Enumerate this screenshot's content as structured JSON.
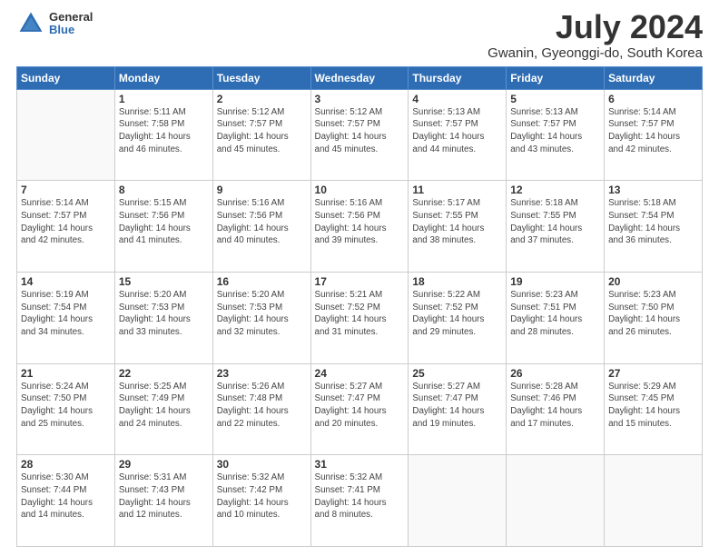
{
  "logo": {
    "general": "General",
    "blue": "Blue"
  },
  "title": "July 2024",
  "subtitle": "Gwanin, Gyeonggi-do, South Korea",
  "weekdays": [
    "Sunday",
    "Monday",
    "Tuesday",
    "Wednesday",
    "Thursday",
    "Friday",
    "Saturday"
  ],
  "weeks": [
    [
      {
        "day": "",
        "info": ""
      },
      {
        "day": "1",
        "info": "Sunrise: 5:11 AM\nSunset: 7:58 PM\nDaylight: 14 hours\nand 46 minutes."
      },
      {
        "day": "2",
        "info": "Sunrise: 5:12 AM\nSunset: 7:57 PM\nDaylight: 14 hours\nand 45 minutes."
      },
      {
        "day": "3",
        "info": "Sunrise: 5:12 AM\nSunset: 7:57 PM\nDaylight: 14 hours\nand 45 minutes."
      },
      {
        "day": "4",
        "info": "Sunrise: 5:13 AM\nSunset: 7:57 PM\nDaylight: 14 hours\nand 44 minutes."
      },
      {
        "day": "5",
        "info": "Sunrise: 5:13 AM\nSunset: 7:57 PM\nDaylight: 14 hours\nand 43 minutes."
      },
      {
        "day": "6",
        "info": "Sunrise: 5:14 AM\nSunset: 7:57 PM\nDaylight: 14 hours\nand 42 minutes."
      }
    ],
    [
      {
        "day": "7",
        "info": "Sunrise: 5:14 AM\nSunset: 7:57 PM\nDaylight: 14 hours\nand 42 minutes."
      },
      {
        "day": "8",
        "info": "Sunrise: 5:15 AM\nSunset: 7:56 PM\nDaylight: 14 hours\nand 41 minutes."
      },
      {
        "day": "9",
        "info": "Sunrise: 5:16 AM\nSunset: 7:56 PM\nDaylight: 14 hours\nand 40 minutes."
      },
      {
        "day": "10",
        "info": "Sunrise: 5:16 AM\nSunset: 7:56 PM\nDaylight: 14 hours\nand 39 minutes."
      },
      {
        "day": "11",
        "info": "Sunrise: 5:17 AM\nSunset: 7:55 PM\nDaylight: 14 hours\nand 38 minutes."
      },
      {
        "day": "12",
        "info": "Sunrise: 5:18 AM\nSunset: 7:55 PM\nDaylight: 14 hours\nand 37 minutes."
      },
      {
        "day": "13",
        "info": "Sunrise: 5:18 AM\nSunset: 7:54 PM\nDaylight: 14 hours\nand 36 minutes."
      }
    ],
    [
      {
        "day": "14",
        "info": "Sunrise: 5:19 AM\nSunset: 7:54 PM\nDaylight: 14 hours\nand 34 minutes."
      },
      {
        "day": "15",
        "info": "Sunrise: 5:20 AM\nSunset: 7:53 PM\nDaylight: 14 hours\nand 33 minutes."
      },
      {
        "day": "16",
        "info": "Sunrise: 5:20 AM\nSunset: 7:53 PM\nDaylight: 14 hours\nand 32 minutes."
      },
      {
        "day": "17",
        "info": "Sunrise: 5:21 AM\nSunset: 7:52 PM\nDaylight: 14 hours\nand 31 minutes."
      },
      {
        "day": "18",
        "info": "Sunrise: 5:22 AM\nSunset: 7:52 PM\nDaylight: 14 hours\nand 29 minutes."
      },
      {
        "day": "19",
        "info": "Sunrise: 5:23 AM\nSunset: 7:51 PM\nDaylight: 14 hours\nand 28 minutes."
      },
      {
        "day": "20",
        "info": "Sunrise: 5:23 AM\nSunset: 7:50 PM\nDaylight: 14 hours\nand 26 minutes."
      }
    ],
    [
      {
        "day": "21",
        "info": "Sunrise: 5:24 AM\nSunset: 7:50 PM\nDaylight: 14 hours\nand 25 minutes."
      },
      {
        "day": "22",
        "info": "Sunrise: 5:25 AM\nSunset: 7:49 PM\nDaylight: 14 hours\nand 24 minutes."
      },
      {
        "day": "23",
        "info": "Sunrise: 5:26 AM\nSunset: 7:48 PM\nDaylight: 14 hours\nand 22 minutes."
      },
      {
        "day": "24",
        "info": "Sunrise: 5:27 AM\nSunset: 7:47 PM\nDaylight: 14 hours\nand 20 minutes."
      },
      {
        "day": "25",
        "info": "Sunrise: 5:27 AM\nSunset: 7:47 PM\nDaylight: 14 hours\nand 19 minutes."
      },
      {
        "day": "26",
        "info": "Sunrise: 5:28 AM\nSunset: 7:46 PM\nDaylight: 14 hours\nand 17 minutes."
      },
      {
        "day": "27",
        "info": "Sunrise: 5:29 AM\nSunset: 7:45 PM\nDaylight: 14 hours\nand 15 minutes."
      }
    ],
    [
      {
        "day": "28",
        "info": "Sunrise: 5:30 AM\nSunset: 7:44 PM\nDaylight: 14 hours\nand 14 minutes."
      },
      {
        "day": "29",
        "info": "Sunrise: 5:31 AM\nSunset: 7:43 PM\nDaylight: 14 hours\nand 12 minutes."
      },
      {
        "day": "30",
        "info": "Sunrise: 5:32 AM\nSunset: 7:42 PM\nDaylight: 14 hours\nand 10 minutes."
      },
      {
        "day": "31",
        "info": "Sunrise: 5:32 AM\nSunset: 7:41 PM\nDaylight: 14 hours\nand 8 minutes."
      },
      {
        "day": "",
        "info": ""
      },
      {
        "day": "",
        "info": ""
      },
      {
        "day": "",
        "info": ""
      }
    ]
  ]
}
